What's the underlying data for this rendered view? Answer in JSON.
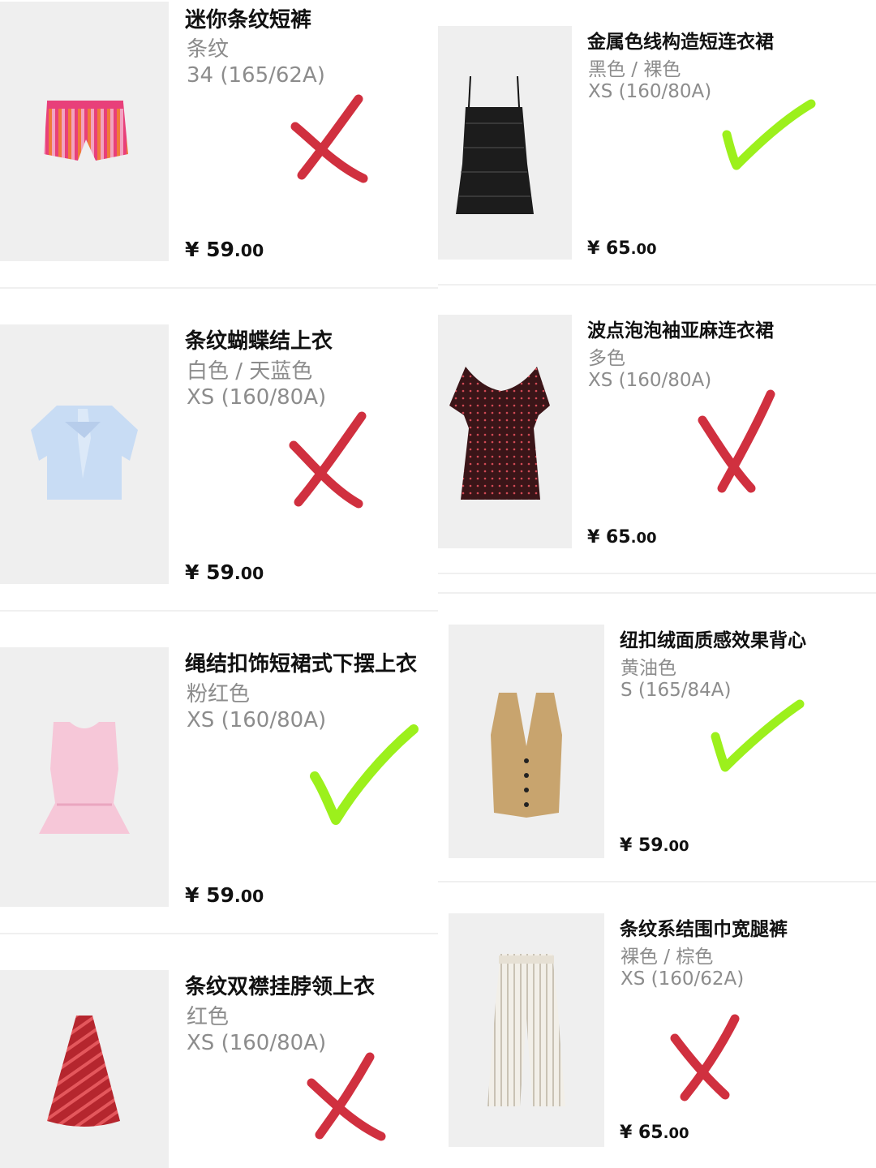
{
  "products": [
    {
      "name": "迷你条纹短裤",
      "color": "条纹",
      "size": "34 (165/62A)",
      "price": {
        "currency": "¥",
        "integer": "59",
        "decimal": ".00"
      },
      "mark": "cross",
      "image": "striped-shorts"
    },
    {
      "name": "条纹蝴蝶结上衣",
      "color": "白色 / 天蓝色",
      "size": "XS (160/80A)",
      "price": {
        "currency": "¥",
        "integer": "59",
        "decimal": ".00"
      },
      "mark": "cross",
      "image": "bow-blouse"
    },
    {
      "name": "绳结扣饰短裙式下摆上衣",
      "color": "粉红色",
      "size": "XS (160/80A)",
      "price": {
        "currency": "¥",
        "integer": "59",
        "decimal": ".00"
      },
      "mark": "check",
      "image": "peplum-top"
    },
    {
      "name": "条纹双襟挂脖领上衣",
      "color": "红色",
      "size": "XS (160/80A)",
      "price": {
        "currency": "¥",
        "integer": "",
        "decimal": ""
      },
      "mark": "cross",
      "image": "halter-top"
    },
    {
      "name": "金属色线构造短连衣裙",
      "color": "黑色 / 裸色",
      "size": "XS (160/80A)",
      "price": {
        "currency": "¥",
        "integer": "65",
        "decimal": ".00"
      },
      "mark": "check",
      "image": "tweed-dress"
    },
    {
      "name": "波点泡泡袖亚麻连衣裙",
      "color": "多色",
      "size": "XS (160/80A)",
      "price": {
        "currency": "¥",
        "integer": "65",
        "decimal": ".00"
      },
      "mark": "cross",
      "image": "polka-dress"
    },
    {
      "name": "纽扣绒面质感效果背心",
      "color": "黄油色",
      "size": "S (165/84A)",
      "price": {
        "currency": "¥",
        "integer": "59",
        "decimal": ".00"
      },
      "mark": "check",
      "image": "suede-vest"
    },
    {
      "name": "条纹系结围巾宽腿裤",
      "color": "裸色 / 棕色",
      "size": "XS (160/62A)",
      "price": {
        "currency": "¥",
        "integer": "65",
        "decimal": ".00"
      },
      "mark": "cross",
      "image": "wide-pants"
    }
  ],
  "colors": {
    "cross": "#d0303f",
    "check": "#9cf01c"
  }
}
